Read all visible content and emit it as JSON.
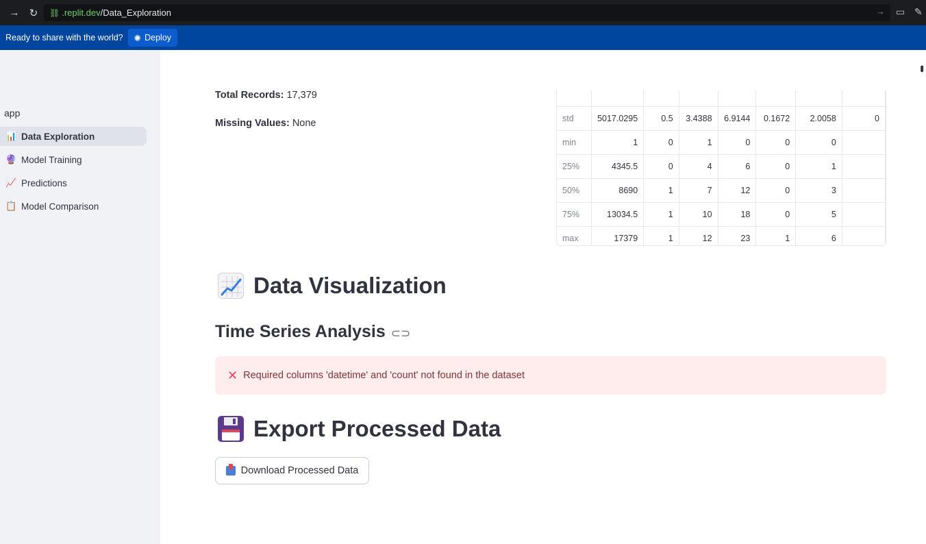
{
  "browser": {
    "url_host": ".replit.dev",
    "url_path": "/Data_Exploration"
  },
  "banner": {
    "text": "Ready to share with the world?",
    "deploy_label": "Deploy"
  },
  "sidebar": {
    "app_label": "app",
    "items": [
      {
        "label": "Data Exploration",
        "icon": "bar-chart-icon",
        "active": true
      },
      {
        "label": "Model Training",
        "icon": "crystal-ball-icon",
        "active": false
      },
      {
        "label": "Predictions",
        "icon": "trend-up-icon",
        "active": false
      },
      {
        "label": "Model Comparison",
        "icon": "clipboard-icon",
        "active": false
      }
    ]
  },
  "stats": {
    "total_label": "Total Records:",
    "total_value": "17,379",
    "missing_label": "Missing Values:",
    "missing_value": "None"
  },
  "describe_table": {
    "rows": [
      {
        "label": "std",
        "values": [
          "5017.0295",
          "0.5",
          "3.4388",
          "6.9144",
          "0.1672",
          "2.0058",
          "0"
        ]
      },
      {
        "label": "min",
        "values": [
          "1",
          "0",
          "1",
          "0",
          "0",
          "0",
          ""
        ]
      },
      {
        "label": "25%",
        "values": [
          "4345.5",
          "0",
          "4",
          "6",
          "0",
          "1",
          ""
        ]
      },
      {
        "label": "50%",
        "values": [
          "8690",
          "1",
          "7",
          "12",
          "0",
          "3",
          ""
        ]
      },
      {
        "label": "75%",
        "values": [
          "13034.5",
          "1",
          "10",
          "18",
          "0",
          "5",
          ""
        ]
      },
      {
        "label": "max",
        "values": [
          "17379",
          "1",
          "12",
          "23",
          "1",
          "6",
          ""
        ]
      }
    ]
  },
  "sections": {
    "viz_title": "Data Visualization",
    "ts_title": "Time Series Analysis",
    "error_text": "Required columns 'datetime' and 'count' not found in the dataset",
    "export_title": "Export Processed Data",
    "download_label": "Download Processed Data"
  },
  "colors": {
    "banner": "#00469e",
    "sidebar_bg": "#f0f2f6",
    "error_bg": "#ffecec",
    "error_text": "#7d353b"
  }
}
